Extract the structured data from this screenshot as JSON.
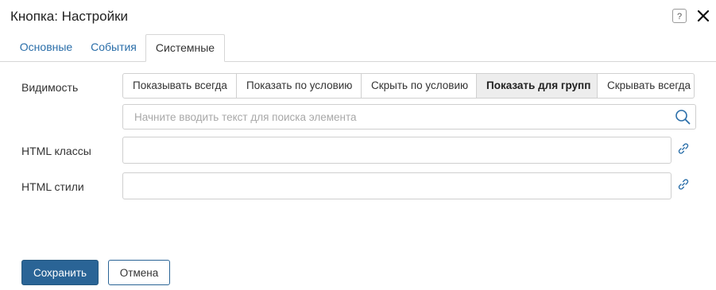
{
  "dialog": {
    "title": "Кнопка: Настройки",
    "help_label": "?"
  },
  "tabs": [
    {
      "label": "Основные",
      "active": false
    },
    {
      "label": "События",
      "active": false
    },
    {
      "label": "Системные",
      "active": true
    }
  ],
  "visibility": {
    "label": "Видимость",
    "options": [
      {
        "label": "Показывать всегда",
        "selected": false
      },
      {
        "label": "Показать по условию",
        "selected": false
      },
      {
        "label": "Скрыть по условию",
        "selected": false
      },
      {
        "label": "Показать для групп",
        "selected": true
      },
      {
        "label": "Скрывать всегда",
        "selected": false
      }
    ],
    "search": {
      "placeholder": "Начните вводить текст для поиска элемента",
      "value": ""
    }
  },
  "html_classes": {
    "label": "HTML классы",
    "value": ""
  },
  "html_styles": {
    "label": "HTML стили",
    "value": ""
  },
  "footer": {
    "save_label": "Сохранить",
    "cancel_label": "Отмена"
  },
  "colors": {
    "accent": "#2a6496",
    "link": "#2a6ea9",
    "border": "#d0d0d0",
    "selected_segment_bg": "#ededed"
  },
  "icons": {
    "help": "question-icon",
    "close": "close-icon",
    "search": "search-icon",
    "link": "link-icon"
  }
}
